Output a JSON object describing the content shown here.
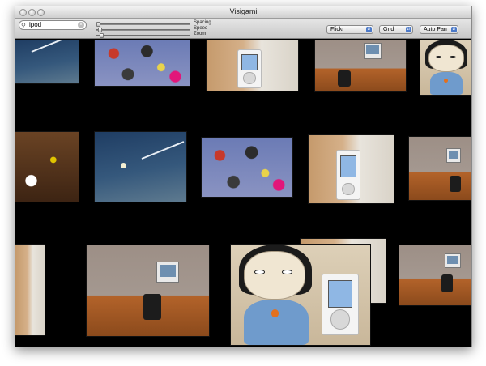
{
  "window": {
    "title": "Visigami"
  },
  "search": {
    "value": "ipod",
    "icon": "magnifier-icon"
  },
  "sliders": [
    {
      "label": "Spacing",
      "value": 0.05
    },
    {
      "label": "Speed",
      "value": 0.05
    },
    {
      "label": "Zoom",
      "value": 0.05
    }
  ],
  "popups": {
    "source": "Flickr",
    "layout": "Grid",
    "pan": "Auto Pan"
  },
  "colors": {
    "canvas": "#000000",
    "accent": "#4b79c8"
  }
}
